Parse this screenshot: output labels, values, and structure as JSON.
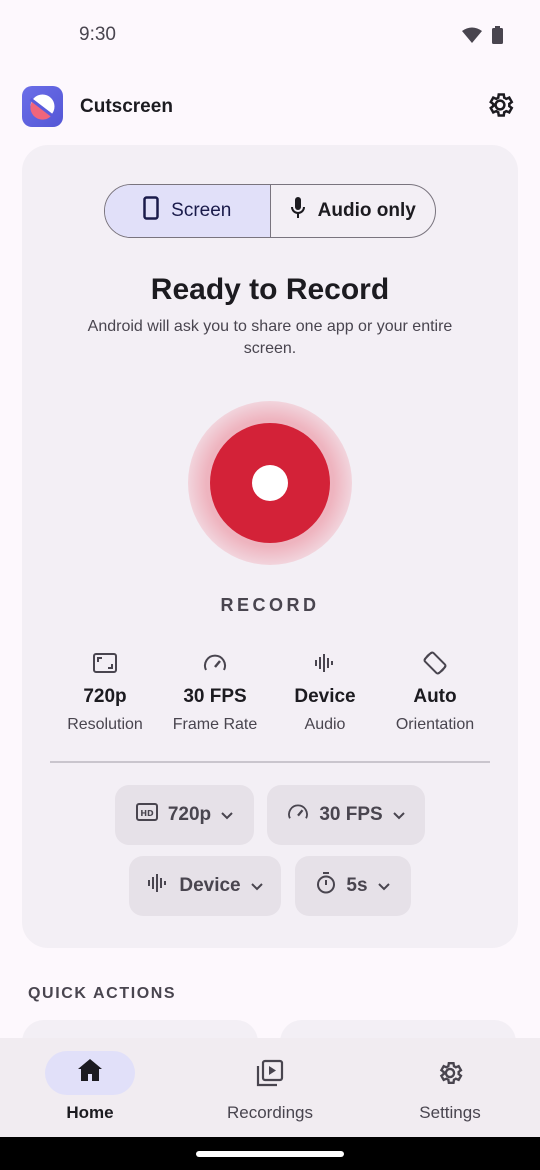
{
  "status_bar": {
    "time": "9:30"
  },
  "app_bar": {
    "title": "Cutscreen"
  },
  "mode_toggle": {
    "options": [
      {
        "label": "Screen",
        "icon": "phone-icon",
        "selected": true
      },
      {
        "label": "Audio only",
        "icon": "mic-icon",
        "selected": false
      }
    ]
  },
  "recorder": {
    "title": "Ready to Record",
    "subtitle": "Android will ask you to share one app or your entire screen.",
    "record_label": "RECORD"
  },
  "stats": [
    {
      "icon": "resolution-icon",
      "value": "720p",
      "label": "Resolution"
    },
    {
      "icon": "speed-icon",
      "value": "30 FPS",
      "label": "Frame Rate"
    },
    {
      "icon": "audio-wave-icon",
      "value": "Device",
      "label": "Audio"
    },
    {
      "icon": "rotate-icon",
      "value": "Auto",
      "label": "Orientation"
    }
  ],
  "chips": [
    {
      "icon": "hd-icon",
      "label": "720p"
    },
    {
      "icon": "speed-icon",
      "label": "30 FPS"
    },
    {
      "icon": "audio-wave-icon",
      "label": "Device"
    },
    {
      "icon": "timer-icon",
      "label": "5s"
    }
  ],
  "quick_actions": {
    "title": "QUICK ACTIONS"
  },
  "nav": {
    "items": [
      {
        "label": "Home",
        "icon": "home-icon",
        "active": true
      },
      {
        "label": "Recordings",
        "icon": "video-library-icon",
        "active": false
      },
      {
        "label": "Settings",
        "icon": "gear-icon",
        "active": false
      }
    ]
  },
  "colors": {
    "record": "#d32238",
    "accent_container": "#e1e0f9",
    "surface": "#f3eff5",
    "chip": "#e6e1e8"
  }
}
